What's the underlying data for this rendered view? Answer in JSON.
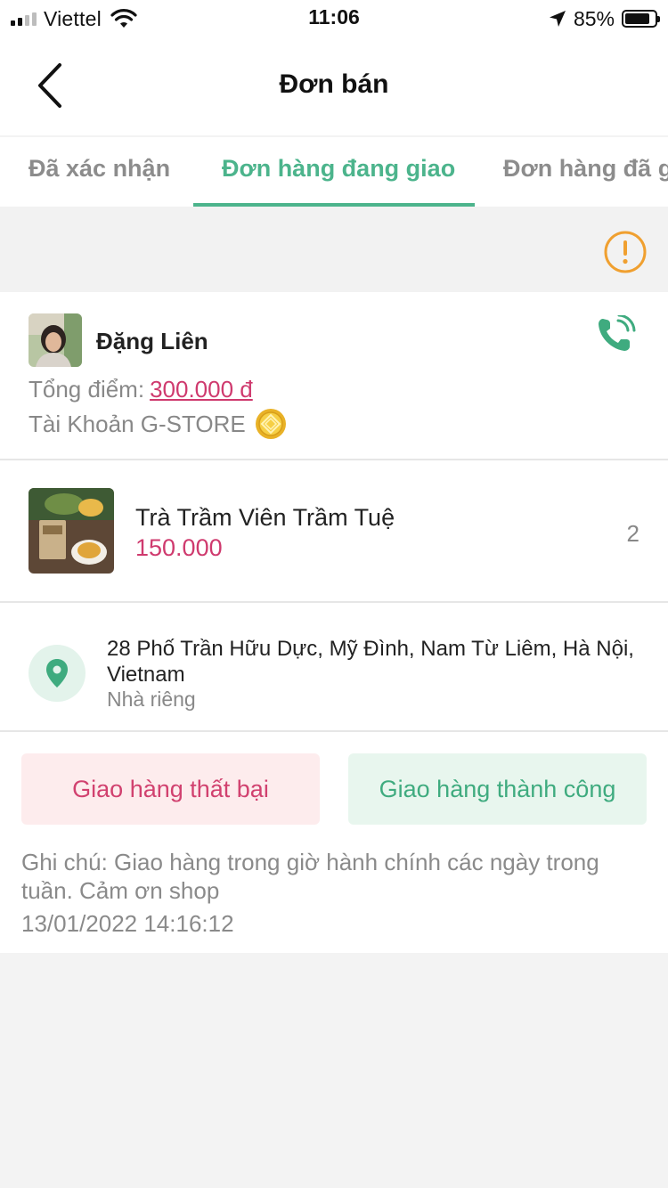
{
  "status_bar": {
    "carrier": "Viettel",
    "time": "11:06",
    "battery_percent": "85%",
    "battery_level": 0.85,
    "icons": [
      "signal-icon",
      "wifi-icon",
      "location-arrow-icon",
      "battery-icon"
    ]
  },
  "nav": {
    "title": "Đơn bán",
    "back_icon": "chevron-left-icon"
  },
  "tabs": [
    {
      "label": "Đã xác nhận",
      "active": false
    },
    {
      "label": "Đơn hàng đang giao",
      "active": true
    },
    {
      "label": "Đơn hàng đã giao",
      "active": false
    }
  ],
  "info_icon": "warning-circle-icon",
  "order": {
    "customer": {
      "name": "Đặng Liên",
      "points_label": "Tổng điểm:",
      "points_value": "300.000 đ",
      "account_label": "Tài Khoản G-STORE",
      "phone_icon": "phone-icon",
      "badge_icon": "gold-coin-icon"
    },
    "product": {
      "name": "Trà Trầm Viên Trầm Tuệ",
      "price": "150.000",
      "quantity": "2"
    },
    "address": {
      "line": "28 Phố Trần Hữu Dực, Mỹ Đình, Nam Từ Liêm, Hà Nội, Vietnam",
      "type": "Nhà riêng",
      "icon": "location-pin-icon"
    },
    "actions": {
      "fail_label": "Giao hàng thất bại",
      "success_label": "Giao hàng thành công"
    },
    "note": "Ghi chú: Giao hàng trong giờ hành chính các ngày trong tuần. Cảm ơn shop",
    "timestamp": "13/01/2022 14:16:12"
  },
  "colors": {
    "accent_green": "#4cb48c",
    "price_pink": "#cf3a6e",
    "warning_orange": "#f0a030",
    "fail_bg": "#fdeced",
    "success_bg": "#e8f6ee"
  }
}
